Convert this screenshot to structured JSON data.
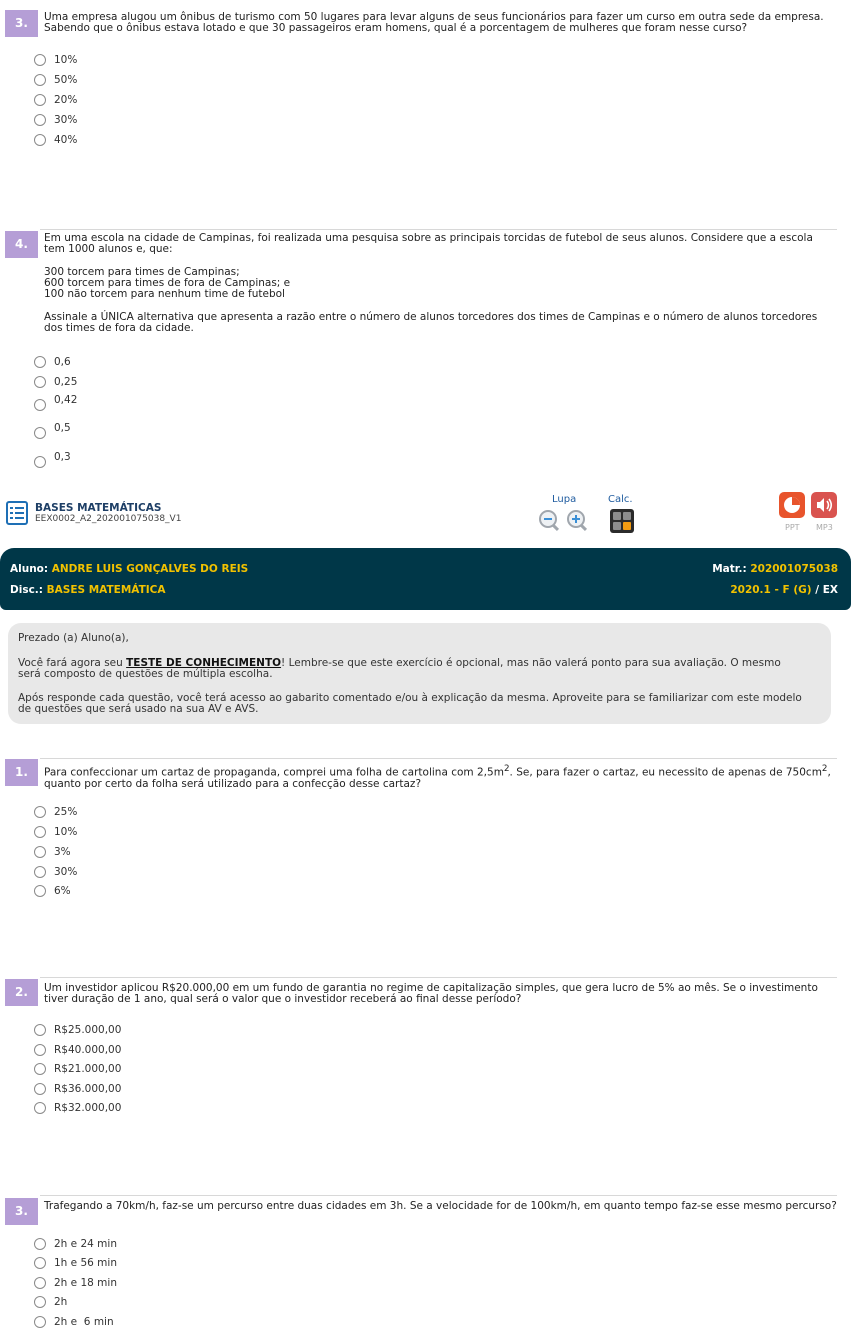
{
  "q3_top": {
    "number": "3.",
    "text": "Uma empresa alugou um ônibus de turismo com 50 lugares para levar alguns de seus funcionários para fazer um curso em outra sede da empresa. Sabendo que o ônibus estava lotado e que 30 passageiros eram homens, qual é a porcentagem de mulheres que foram nesse curso?",
    "options": [
      "10%",
      "50%",
      "20%",
      "30%",
      "40%"
    ]
  },
  "q4_top": {
    "number": "4.",
    "intro": "Em uma escola na cidade de Campinas, foi realizada uma pesquisa sobre as principais torcidas de futebol de seus alunos. Considere que a escola tem 1000 alunos e, que:",
    "line1": "300 torcem para times de Campinas;",
    "line2": "600 torcem para times de fora de Campinas; e",
    "line3": "100 não torcem para nenhum time de futebol",
    "question": "Assinale a ÚNICA alternativa que apresenta a razão entre o número de alunos torcedores dos times de Campinas e o número de alunos torcedores dos times de fora da cidade.",
    "options": [
      "0,6",
      "0,25",
      "0,42",
      "0,5",
      "0,3"
    ]
  },
  "toolbar": {
    "subject": "BASES MATEMÁTICAS",
    "code": "EEX0002_A2_202001075038_V1",
    "lupa_label": "Lupa",
    "calc_label": "Calc.",
    "ppt_label": "PPT",
    "mp3_label": "MP3",
    "ppt_color": "#e8542c",
    "mp3_color": "#d9534f"
  },
  "banner": {
    "aluno_label": "Aluno:",
    "aluno_value": "ANDRE LUIS GONÇALVES DO REIS",
    "matr_label": "Matr.:",
    "matr_value": "202001075038",
    "disc_label": "Disc.:",
    "disc_value": "BASES MATEMÁTICA",
    "period_value": "2020.1 - F (G)",
    "period_sep": "/",
    "period_type": "EX"
  },
  "info": {
    "greeting": "Prezado (a) Aluno(a),",
    "p1_before": "Você fará agora seu ",
    "p1_bold": "TESTE DE CONHECIMENTO",
    "p1_after": "! Lembre-se que este exercício é opcional, mas não valerá ponto para sua avaliação. O mesmo será composto de questões de múltipla escolha.",
    "p2": "Após responde cada questão, você terá acesso ao gabarito comentado e/ou à explicação da mesma. Aproveite para se familiarizar com este modelo de questões que será usado na sua AV e AVS."
  },
  "q1": {
    "number": "1.",
    "text_a": "Para confeccionar um cartaz de propaganda, comprei uma folha de cartolina com 2,5m",
    "text_b": ". Se, para fazer o cartaz, eu necessito de apenas de 750cm",
    "text_c": ", quanto por certo da folha será utilizado para a confecção desse cartaz?",
    "sup": "2",
    "options": [
      "25%",
      "10%",
      "3%",
      "30%",
      "6%"
    ]
  },
  "q2": {
    "number": "2.",
    "text": "Um investidor aplicou R$20.000,00 em um fundo de garantia no regime de capitalização simples, que gera lucro de 5% ao mês. Se o investimento tiver duração de 1 ano, qual será o valor que o investidor receberá ao final desse período?",
    "options": [
      "R$25.000,00",
      "R$40.000,00",
      "R$21.000,00",
      "R$36.000,00",
      "R$32.000,00"
    ]
  },
  "q3": {
    "number": "3.",
    "text": "Trafegando a 70km/h, faz-se um percurso entre duas cidades em 3h. Se a velocidade for de 100km/h, em quanto tempo faz-se esse mesmo percurso?",
    "options": [
      "2h e 24 min",
      "1h e 56 min",
      "2h e 18 min",
      "2h",
      "2h e  6 min"
    ]
  }
}
